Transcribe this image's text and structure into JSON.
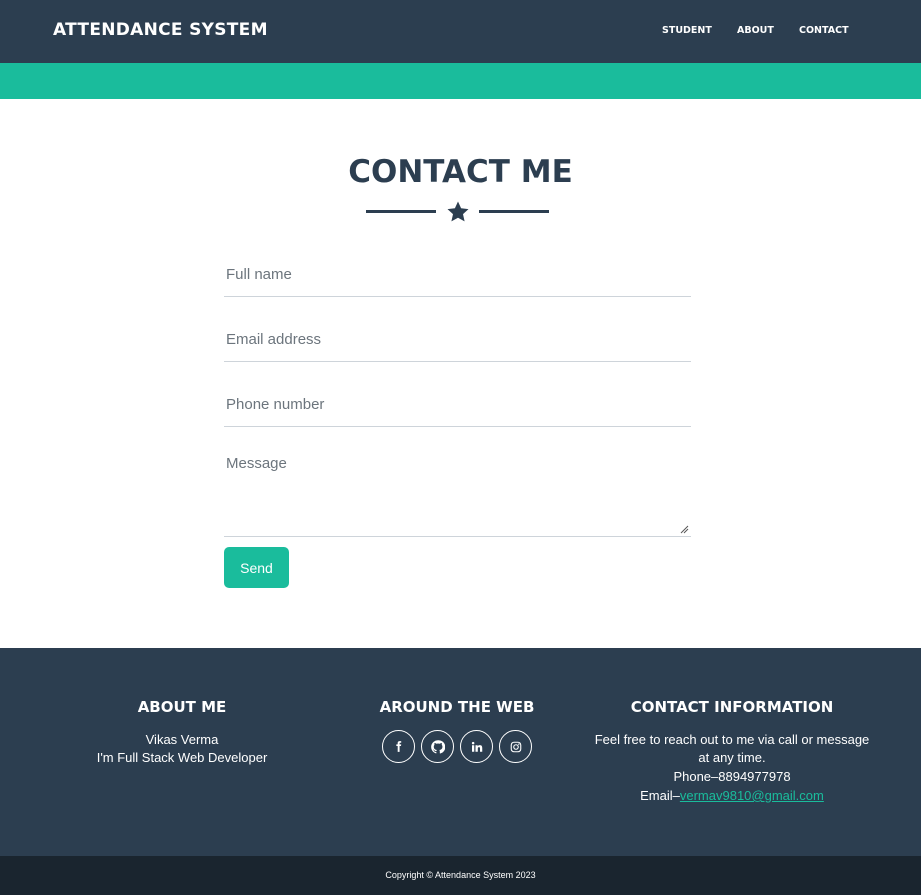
{
  "navbar": {
    "brand": "ATTENDANCE SYSTEM",
    "links": [
      "STUDENT",
      "ABOUT",
      "CONTACT"
    ]
  },
  "contact": {
    "title": "CONTACT ME",
    "form": {
      "full_name_placeholder": "Full name",
      "email_placeholder": "Email address",
      "phone_placeholder": "Phone number",
      "message_placeholder": "Message",
      "send_label": "Send"
    }
  },
  "footer": {
    "about": {
      "heading": "ABOUT ME",
      "name": "Vikas Verma",
      "tagline": "I'm Full Stack Web Developer"
    },
    "web": {
      "heading": "AROUND THE WEB",
      "icons": [
        "facebook-icon",
        "github-icon",
        "linkedin-icon",
        "instagram-icon"
      ]
    },
    "contact_info": {
      "heading": "CONTACT INFORMATION",
      "line1": "Feel free to reach out to me via call or message",
      "line2": "at any time.",
      "phone": "Phone–8894977978",
      "email_prefix": "Email–",
      "email": "vermav9810@gmail.com"
    }
  },
  "copyright": "Copyright © Attendance System 2023",
  "colors": {
    "primary": "#2c3e50",
    "accent": "#1abc9c",
    "copyright_bg": "#1a252f"
  }
}
